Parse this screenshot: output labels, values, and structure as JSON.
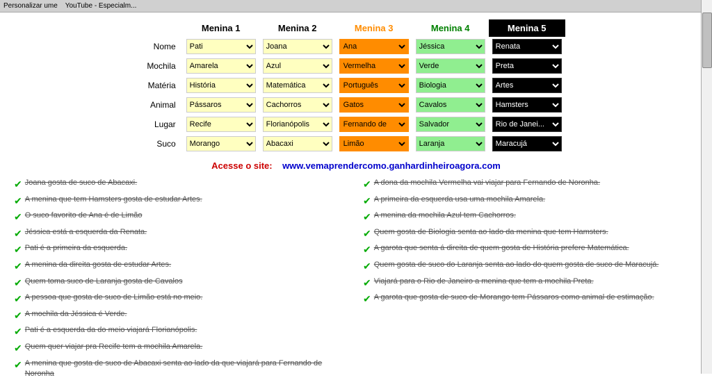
{
  "topbar": {
    "text": "Personalizar ume   YouTube - Especialm..."
  },
  "puzzle": {
    "columns": [
      {
        "id": "menina1",
        "label": "Menina 1",
        "color": "yellow"
      },
      {
        "id": "menina2",
        "label": "Menina 2",
        "color": "yellow"
      },
      {
        "id": "menina3",
        "label": "Menina 3",
        "color": "orange"
      },
      {
        "id": "menina4",
        "label": "Menina 4",
        "color": "green"
      },
      {
        "id": "menina5",
        "label": "Menina 5",
        "color": "black"
      }
    ],
    "rows": [
      {
        "label": "Nome",
        "values": [
          "Pati",
          "Joana",
          "Ana",
          "Jéssica",
          "Renata"
        ]
      },
      {
        "label": "Mochila",
        "values": [
          "Amarela",
          "Azul",
          "Vermelha",
          "Verde",
          "Preta"
        ]
      },
      {
        "label": "Matéria",
        "values": [
          "História",
          "Matemática",
          "Português",
          "Biologia",
          "Artes"
        ]
      },
      {
        "label": "Animal",
        "values": [
          "Pássaros",
          "Cachorros",
          "Gatos",
          "Cavalos",
          "Hamsters"
        ]
      },
      {
        "label": "Lugar",
        "values": [
          "Recife",
          "Florianópolis",
          "Fernando de",
          "Salvador",
          "Rio de Janei..."
        ]
      },
      {
        "label": "Suco",
        "values": [
          "Morango",
          "Abacaxi",
          "Limão",
          "Laranja",
          "Maracujá"
        ]
      }
    ]
  },
  "website": {
    "label": "Acesse o site:",
    "url": "www.vemaprendercomo.ganhardinheiroagora.com"
  },
  "clues_left": [
    "Joana gosta de suco de Abacaxi.",
    "A menina que tem Hamsters gosta de estudar Artes.",
    "O suco favorito de Ana é de Limão",
    "Jéssica está a esquerda da Renata.",
    "Pati é a primeira da esquerda.",
    "A menina da direita gosta de estudar Artes.",
    "Quem toma suco de Laranja gosta de Cavalos",
    "A pessoa que gosta de suco de Limão está no meio.",
    "A mochila da Jéssica é Verde.",
    "Pati é a esquerda da do meio viajará Florianópolis.",
    "Quem quer viajar pra Recife tem a mochila Amarela.",
    "A menina que gosta de suco de Abacaxi senta ao lado da que viajará para Fernando de Noronha"
  ],
  "clues_right": [
    "A dona da mochila Vermelha vai viajar para Fernando de Noronha.",
    "A primeira da esquerda usa uma mochila Amarela.",
    "A menina da mochila Azul tem Cachorros.",
    "Quem gosta de Biologia senta ao lado da menina que tem Hamsters.",
    "A garota que senta á direita de quem gosta de História prefere Matemática.",
    "Quem gosta de suco do Laranja senta ao lado do quem gosta de suco de Maracujá.",
    "Viajará para o Rio de Janeiro a menina que tem a mochila Preta.",
    "A garota que gosta de suco de Morango tem Pássaros como animal de estimação."
  ]
}
